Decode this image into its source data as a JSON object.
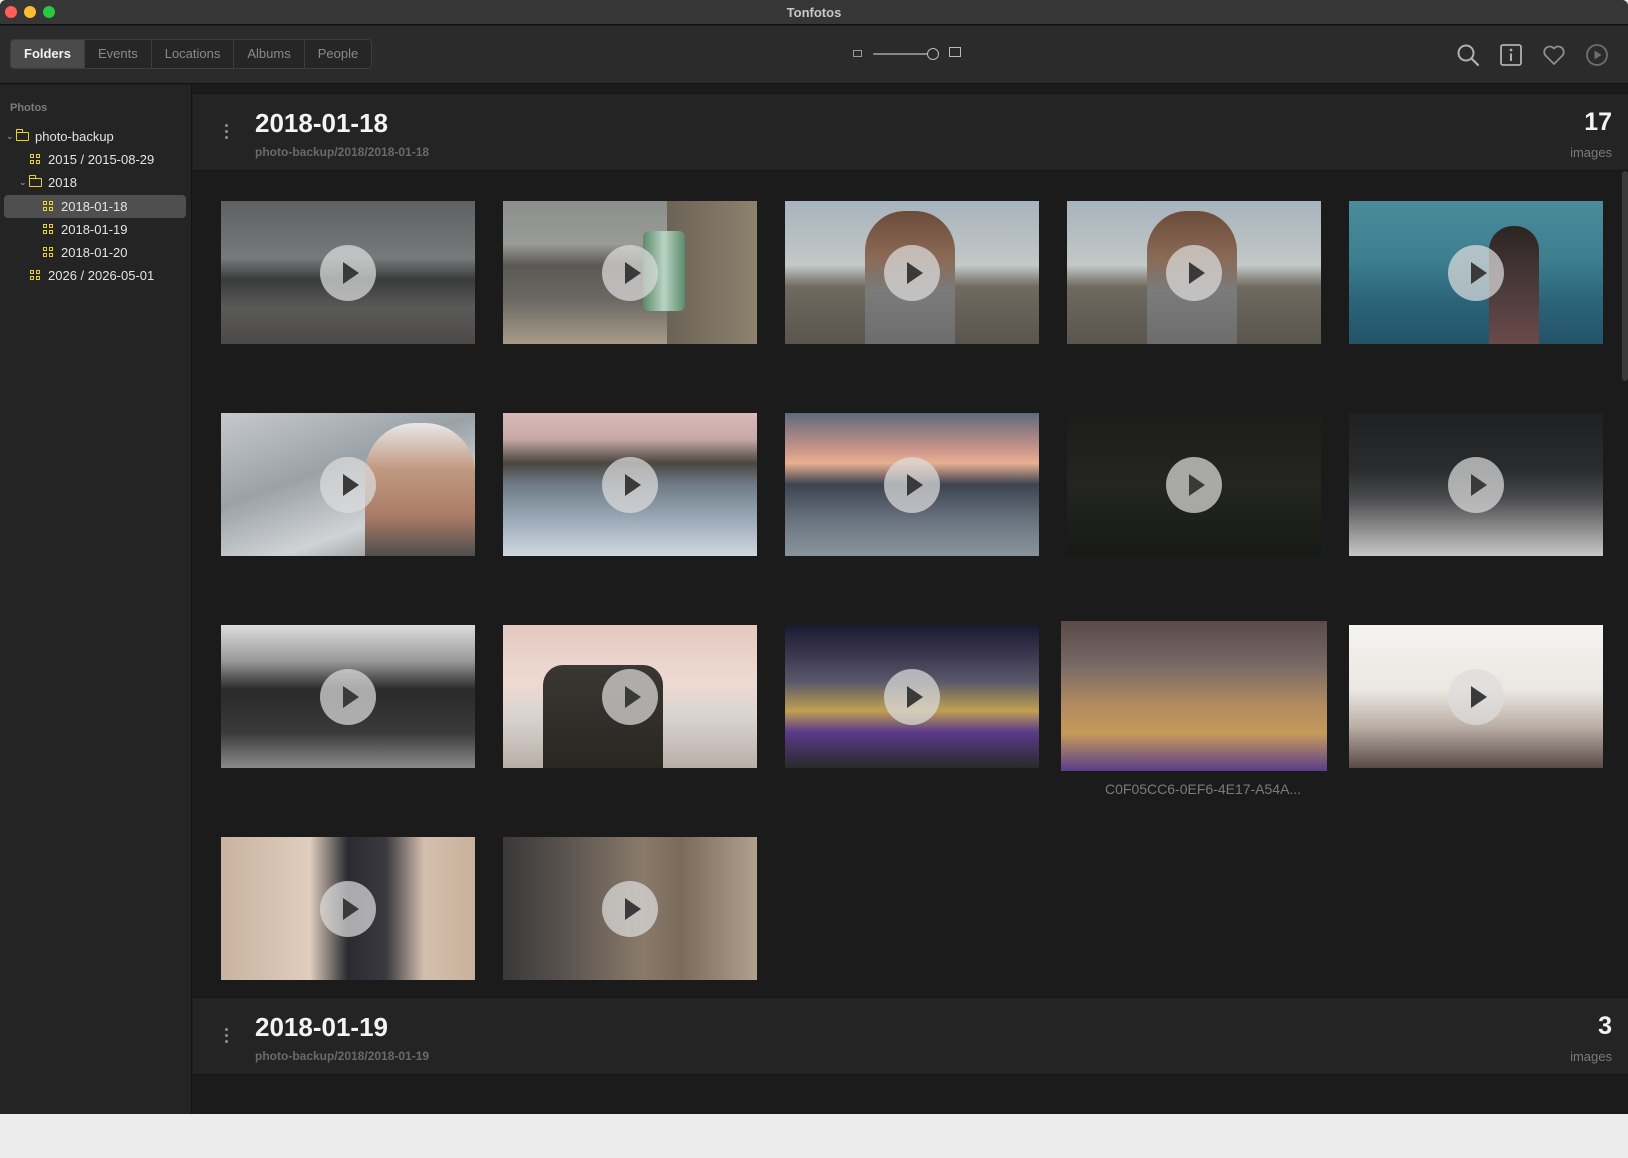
{
  "window": {
    "title": "Tonfotos"
  },
  "toolbar": {
    "tabs": [
      {
        "label": "Folders",
        "active": true
      },
      {
        "label": "Events",
        "active": false
      },
      {
        "label": "Locations",
        "active": false
      },
      {
        "label": "Albums",
        "active": false
      },
      {
        "label": "People",
        "active": false
      }
    ],
    "zoom_slider_level": 0.93,
    "icons": [
      "search-icon",
      "info-icon",
      "heart-icon",
      "play-circle-icon"
    ]
  },
  "sidebar": {
    "section_label": "Photos",
    "items": [
      {
        "label": "photo-backup",
        "icon": "folder-icon",
        "expanded": true
      },
      {
        "label": "2015 / 2015-08-29",
        "icon": "grid-icon"
      },
      {
        "label": "2018",
        "icon": "folder-icon",
        "expanded": true
      },
      {
        "label": "2018-01-18",
        "icon": "grid-icon",
        "selected": true
      },
      {
        "label": "2018-01-19",
        "icon": "grid-icon"
      },
      {
        "label": "2018-01-20",
        "icon": "grid-icon"
      },
      {
        "label": "2026 / 2026-05-01",
        "icon": "grid-icon"
      }
    ]
  },
  "sections": [
    {
      "title": "2018-01-18",
      "path": "photo-backup/2018/2018-01-18",
      "count": "17",
      "unit": "images"
    },
    {
      "title": "2018-01-19",
      "path": "photo-backup/2018/2018-01-19",
      "count": "3",
      "unit": "images"
    }
  ],
  "thumbnails": [
    {
      "scene": "overcast beach with breakwater",
      "hovered_caption": ""
    },
    {
      "scene": "beer can on driftwood beach",
      "hovered_caption": ""
    },
    {
      "scene": "man in sunglasses holding can on beach",
      "hovered_caption": ""
    },
    {
      "scene": "man in sunglasses holding can on beach",
      "hovered_caption": ""
    },
    {
      "scene": "woman looking at sea",
      "hovered_caption": ""
    },
    {
      "scene": "elderly man selfie on boat",
      "hovered_caption": ""
    },
    {
      "scene": "harbor town at dusk from boat",
      "hovered_caption": ""
    },
    {
      "scene": "boat on sea at sunset",
      "hovered_caption": ""
    },
    {
      "scene": "dark night scene",
      "hovered_caption": ""
    },
    {
      "scene": "people in suits in limo",
      "hovered_caption": ""
    },
    {
      "scene": "group in suits in limo",
      "hovered_caption": ""
    },
    {
      "scene": "two men on white sofa",
      "hovered_caption": ""
    },
    {
      "scene": "basketball arena",
      "hovered_caption": ""
    },
    {
      "scene": "basketball game courtside",
      "hovered_caption": "C0F05CC6-0EF6-4E17-A54A..."
    },
    {
      "scene": "bright blurry arena crowd",
      "hovered_caption": ""
    },
    {
      "scene": "narrow room with equipment",
      "hovered_caption": ""
    },
    {
      "scene": "boxes in dim room",
      "hovered_caption": ""
    }
  ],
  "colors": {
    "accent_folder": "#e8d12a",
    "window_bg": "#1e1e1e",
    "sidebar_selected": "#4f4f4f"
  }
}
